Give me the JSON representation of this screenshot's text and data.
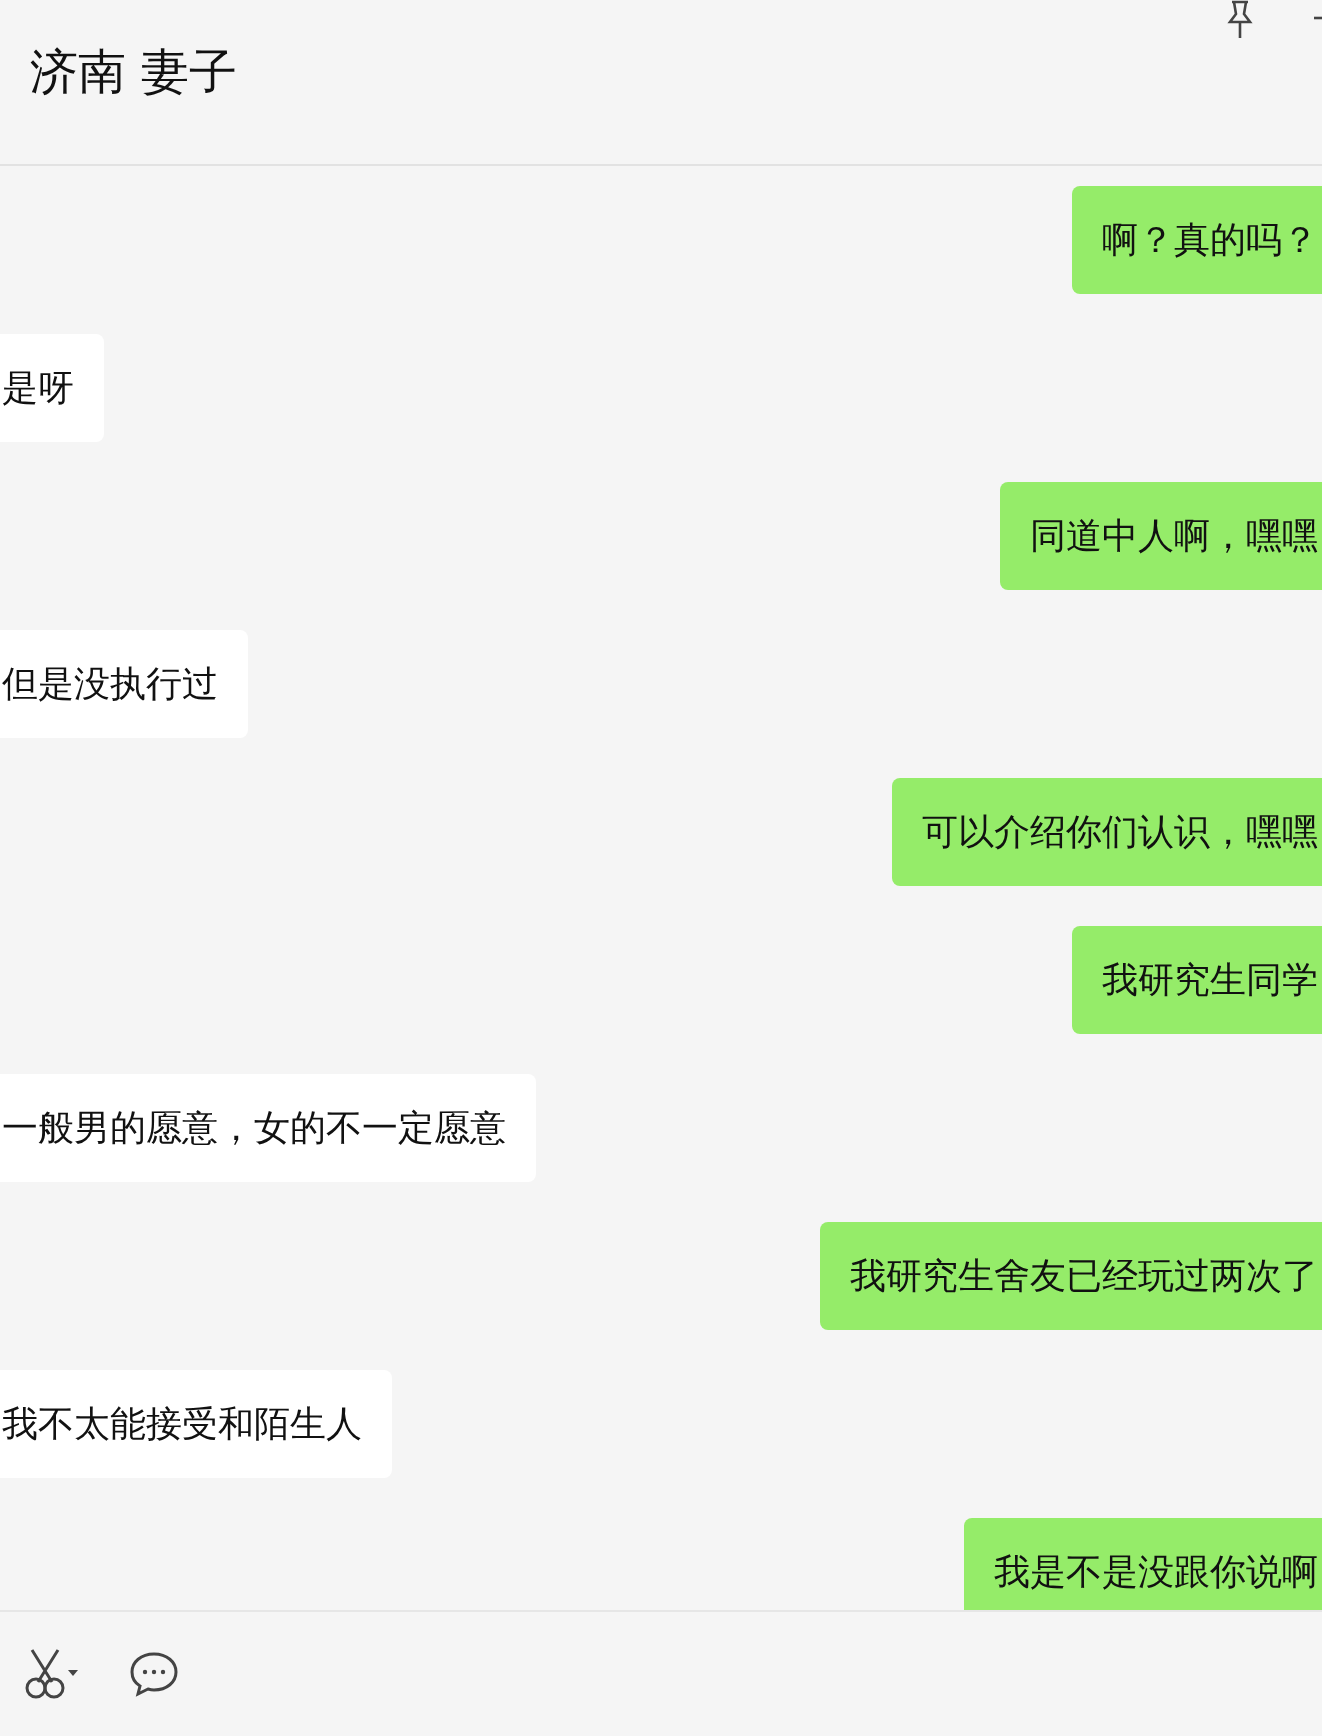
{
  "chat": {
    "title": "济南 妻子"
  },
  "messages": [
    {
      "kind": "sent",
      "text": "啊？真的吗？"
    },
    {
      "kind": "received",
      "text": "是呀"
    },
    {
      "kind": "sent",
      "text": "同道中人啊，嘿嘿"
    },
    {
      "kind": "received",
      "text": "但是没执行过"
    },
    {
      "kind": "sent",
      "text": "可以介绍你们认识，嘿嘿"
    },
    {
      "kind": "sent",
      "text": "我研究生同学"
    },
    {
      "kind": "received",
      "text": "一般男的愿意，女的不一定愿意"
    },
    {
      "kind": "sent",
      "text": "我研究生舍友已经玩过两次了"
    },
    {
      "kind": "received",
      "text": "我不太能接受和陌生人"
    },
    {
      "kind": "sent",
      "text": "我是不是没跟你说啊"
    }
  ]
}
